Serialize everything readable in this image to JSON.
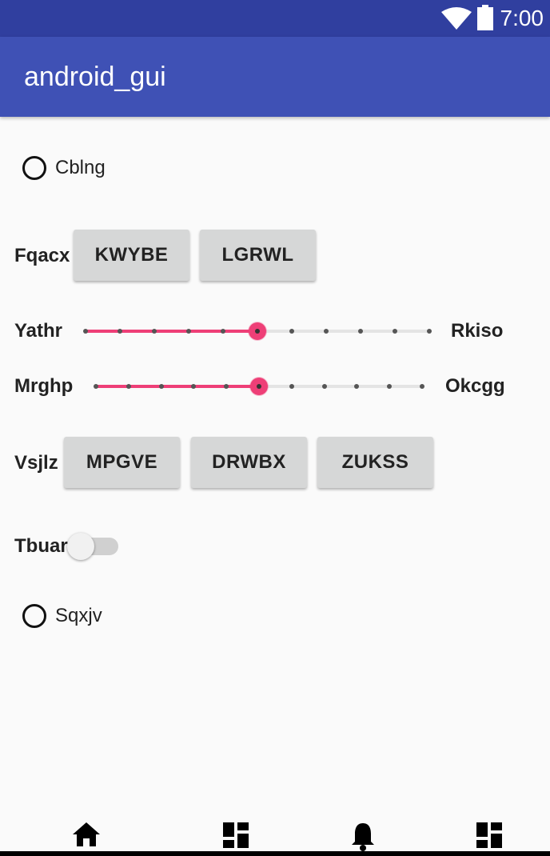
{
  "status_bar": {
    "time": "7:00",
    "wifi_icon": "wifi-icon",
    "battery_icon": "battery-icon"
  },
  "app_bar": {
    "title": "android_gui"
  },
  "radio_1": {
    "label": "Cblng",
    "checked": false
  },
  "row_buttons_1": {
    "label": "Fqacx",
    "buttons": [
      "KWYBE",
      "LGRWL"
    ]
  },
  "slider_1": {
    "left_label": "Yathr",
    "right_label": "Rkiso",
    "value_fraction": 0.5,
    "steps": 10
  },
  "slider_2": {
    "left_label": "Mrghp",
    "right_label": "Okcgg",
    "value_fraction": 0.5,
    "steps": 10
  },
  "row_buttons_2": {
    "label": "Vsjlz",
    "buttons": [
      "MPGVE",
      "DRWBX",
      "ZUKSS"
    ]
  },
  "switch_1": {
    "label": "Tbuar",
    "on": false
  },
  "radio_2": {
    "label": "Sqxjv",
    "checked": false
  },
  "bottom_nav": {
    "items": [
      "home-icon",
      "dashboard-icon",
      "notifications-icon",
      "dashboard-icon"
    ]
  },
  "colors": {
    "primary": "#3f51b5",
    "primary_dark": "#303f9f",
    "accent": "#ee3f77"
  }
}
